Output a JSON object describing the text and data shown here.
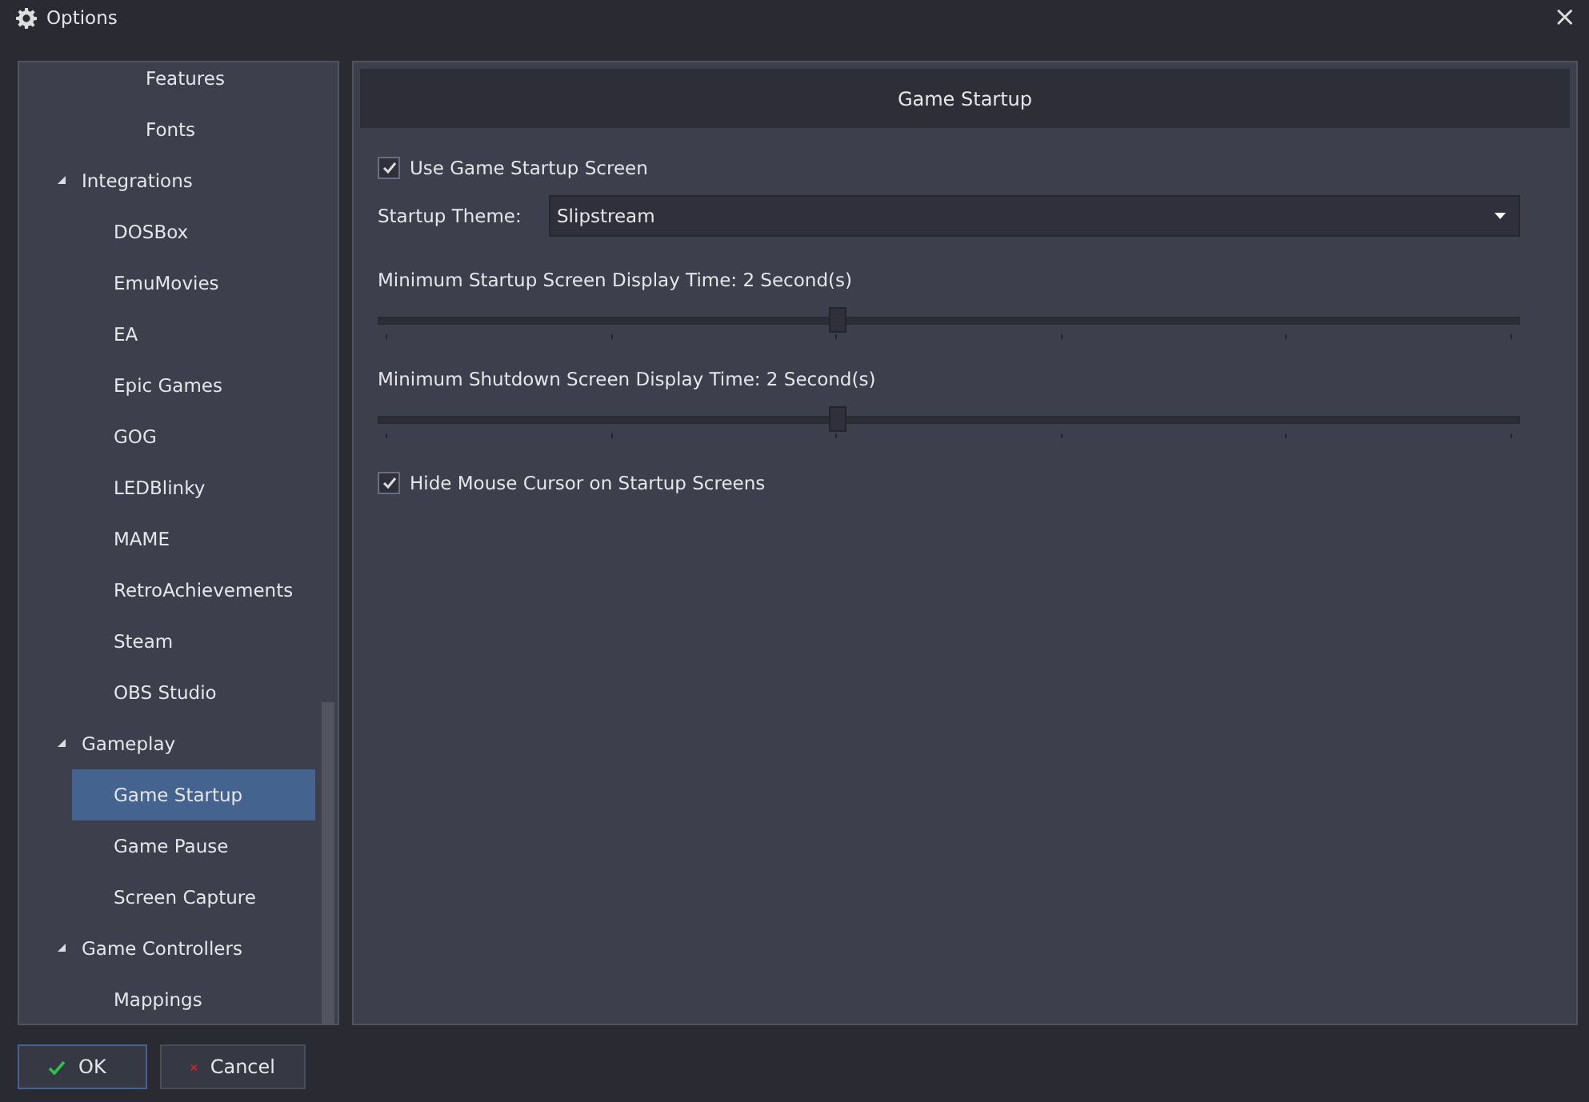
{
  "window": {
    "title": "Options",
    "close": "×"
  },
  "sidebar": {
    "items": [
      {
        "children": [
          {
            "children": [
              {
                "label": "Features",
                "selected": false
              },
              {
                "label": "Fonts",
                "selected": false
              }
            ]
          }
        ]
      },
      {
        "label": "Integrations",
        "expanded": true,
        "selected": false,
        "children": [
          {
            "label": "DOSBox",
            "selected": false
          },
          {
            "label": "EmuMovies",
            "selected": false
          },
          {
            "label": "EA",
            "selected": false
          },
          {
            "label": "Epic Games",
            "selected": false
          },
          {
            "label": "GOG",
            "selected": false
          },
          {
            "label": "LEDBlinky",
            "selected": false
          },
          {
            "label": "MAME",
            "selected": false
          },
          {
            "label": "RetroAchievements",
            "selected": false
          },
          {
            "label": "Steam",
            "selected": false
          },
          {
            "label": "OBS Studio",
            "selected": false
          }
        ]
      },
      {
        "label": "Gameplay",
        "expanded": true,
        "selected": false,
        "children": [
          {
            "label": "Game Startup",
            "selected": true
          },
          {
            "label": "Game Pause",
            "selected": false
          },
          {
            "label": "Screen Capture",
            "selected": false
          }
        ]
      },
      {
        "label": "Game Controllers",
        "expanded": true,
        "selected": false,
        "children": [
          {
            "label": "Mappings",
            "selected": false
          }
        ]
      }
    ]
  },
  "panel": {
    "title": "Game Startup",
    "controls": [
      {
        "kind": "checkbox",
        "label": "Use Game Startup Screen",
        "checked": true
      },
      {
        "kind": "dropdown",
        "label": "Startup Theme:",
        "value": "Slipstream"
      },
      {
        "kind": "slider",
        "label": "Minimum Startup Screen Display Time: 2 Second(s)",
        "level": 0.4
      },
      {
        "kind": "slider",
        "label": "Minimum Shutdown Screen Display Time: 2 Second(s)",
        "level": 0.4
      },
      {
        "kind": "checkbox",
        "label": "Hide Mouse Cursor on Startup Screens",
        "checked": true
      }
    ]
  },
  "buttons": [
    {
      "kind": "ok",
      "label": "OK"
    },
    {
      "kind": "cancel",
      "label": "Cancel"
    }
  ]
}
